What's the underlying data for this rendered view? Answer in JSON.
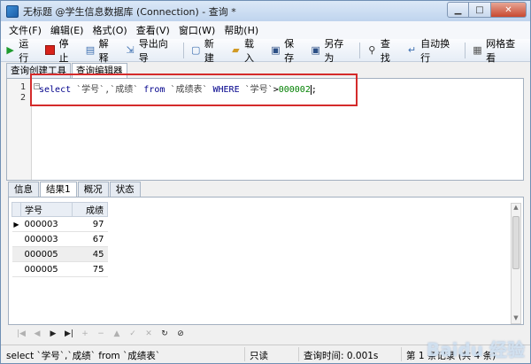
{
  "window": {
    "title": "无标题 @学生信息数据库 (Connection) - 查询 *",
    "controls": [
      "minimize",
      "maximize",
      "close"
    ]
  },
  "menu": [
    "文件(F)",
    "编辑(E)",
    "格式(O)",
    "查看(V)",
    "窗口(W)",
    "帮助(H)"
  ],
  "toolbar": {
    "run": "运行",
    "stop": "停止",
    "explain": "解释",
    "export_wizard": "导出向导",
    "new": "新建",
    "load": "载入",
    "save": "保存",
    "save_as": "另存为",
    "find": "查找",
    "word_wrap": "自动换行",
    "grid_view": "网格查看"
  },
  "editor_tabs": [
    "查询创建工具",
    "查询编辑器"
  ],
  "editor": {
    "line_numbers": [
      "1",
      "2"
    ],
    "tokens": {
      "select": "select",
      "col1": "`学号`,",
      "col2": "`成绩`",
      "from": "from",
      "table": "`成绩表`",
      "where": "WHERE",
      "cond_col": "`学号`",
      "op": ">",
      "value": "000002",
      "end": ";"
    }
  },
  "result_tabs": [
    "信息",
    "结果1",
    "概况",
    "状态"
  ],
  "results": {
    "columns": [
      "学号",
      "成绩"
    ],
    "rows": [
      {
        "学号": "000003",
        "成绩": "97"
      },
      {
        "学号": "000003",
        "成绩": "67"
      },
      {
        "学号": "000005",
        "成绩": "45"
      },
      {
        "学号": "000005",
        "成绩": "75"
      }
    ]
  },
  "status": {
    "sql": "select `学号`,`成绩` from `成绩表`",
    "mode": "只读",
    "query_time": "查询时间: 0.001s",
    "record": "第 1 条记录 (共 4 条)"
  },
  "watermark": "Baidu 经验",
  "colors": {
    "highlight_box": "#d42b2b",
    "keyword": "#00008b",
    "number": "#008000"
  }
}
